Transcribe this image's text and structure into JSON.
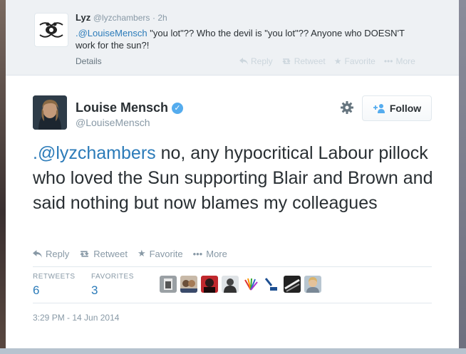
{
  "reply_tweet": {
    "name": "Lyz",
    "handle": "@lyzchambers",
    "time": "· 2h",
    "mention": ".@LouiseMensch",
    "text": " \"you lot\"?? Who the devil is \"you lot\"??  Anyone who DOESN'T work for the sun?!",
    "details_label": "Details",
    "actions": [
      "Reply",
      "Retweet",
      "Favorite",
      "More"
    ]
  },
  "main_tweet": {
    "name": "Louise Mensch",
    "handle": "@LouiseMensch",
    "follow_label": "Follow",
    "mention": ".@lyzchambers",
    "text": " no, any hypocritical Labour pillock who loved the Sun supporting Blair and Brown and said nothing but now blames my colleagues",
    "actions": [
      "Reply",
      "Retweet",
      "Favorite",
      "More"
    ],
    "retweets_label": "RETWEETS",
    "retweets": "6",
    "favorites_label": "FAVORITES",
    "favorites": "3",
    "timestamp": "3:29 PM - 14 Jun 2014"
  },
  "icons": {
    "reply": "reply-icon",
    "retweet": "retweet-icon",
    "favorite": "star-icon",
    "more": "more-icon",
    "settings": "gear-icon",
    "follow": "add-user-icon",
    "verified": "verified-badge-icon"
  },
  "colors": {
    "link": "#2b7bb9",
    "muted": "#8899a6",
    "verified": "#55acee"
  }
}
